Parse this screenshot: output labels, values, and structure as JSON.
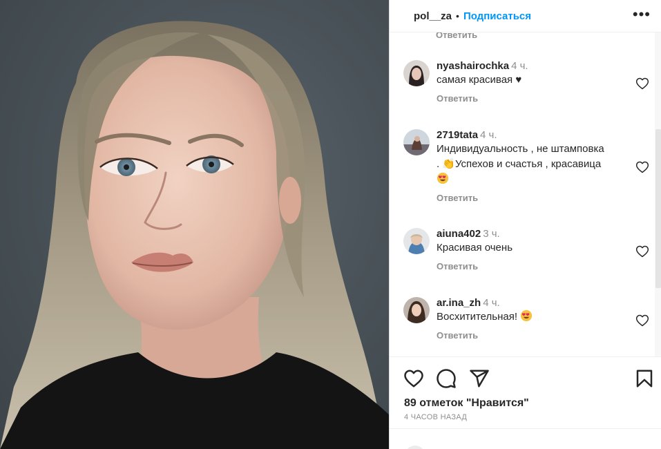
{
  "header": {
    "username": "pol__za",
    "separator": "•",
    "follow_label": "Подписаться",
    "more_label": "•••"
  },
  "top_reply_label": "Ответить",
  "comments": [
    {
      "username": "nyashairochka",
      "time": "4 ч.",
      "text": "самая красивая ♥",
      "reply_label": "Ответить"
    },
    {
      "username": "2719tata",
      "time": "4 ч.",
      "text_line1": "Индивидуальность , не штамповка",
      "text_line2": ". 👏Успехов и счастья , красавица",
      "reply_label": "Ответить"
    },
    {
      "username": "aiuna402",
      "time": "3 ч.",
      "text": "Красивая очень",
      "reply_label": "Ответить"
    },
    {
      "username": "ar.ina_zh",
      "time": "4 ч.",
      "text": "Восхитительная!",
      "reply_label": "Ответить"
    }
  ],
  "icons": {
    "like": "heart-icon",
    "comment": "comment-icon",
    "share": "paper-plane-icon",
    "save": "bookmark-icon",
    "comment_like": "heart-icon",
    "emoji_clap": "clapping-hands",
    "emoji_heart_eyes": "smiling-face-with-heart-eyes"
  },
  "likes_text": "89 отметок \"Нравится\"",
  "time_ago": "4 ЧАСОВ НАЗАД",
  "colors": {
    "accent": "#0095f6",
    "text": "#262626",
    "muted": "#8e8e8e",
    "photo_background": "#4a5359"
  }
}
